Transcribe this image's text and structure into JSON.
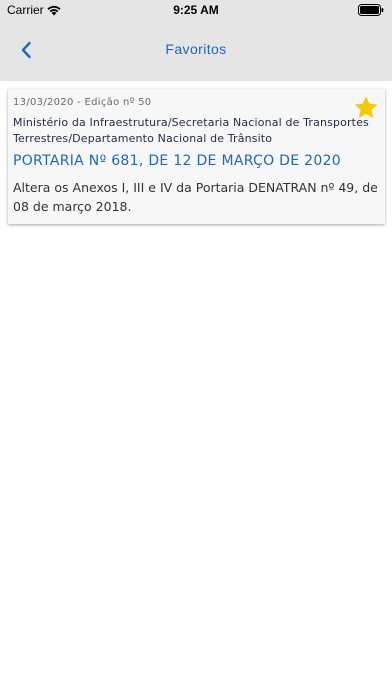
{
  "status_bar": {
    "carrier": "Carrier",
    "time": "9:25 AM",
    "wifi_icon": "wifi-icon",
    "battery_icon": "battery-icon"
  },
  "nav": {
    "title": "Favoritos",
    "back_icon": "chevron-left-icon",
    "accent_color": "#1f66c1"
  },
  "favorites": [
    {
      "date": "13/03/2020",
      "separator": " - ",
      "edition": "Edição nº 50",
      "organ": "Ministério da Infraestrutura/Secretaria Nacional de Transportes Terrestres/Departamento Nacional de Trânsito",
      "title": "PORTARIA Nº 681, DE 12 DE MARÇO DE 2020",
      "summary": "Altera os Anexos I, III e IV da Portaria DENATRAN nº 49, de 08 de março 2018.",
      "favorite_icon": "star-icon",
      "favorite_color": "#f6c800"
    }
  ]
}
